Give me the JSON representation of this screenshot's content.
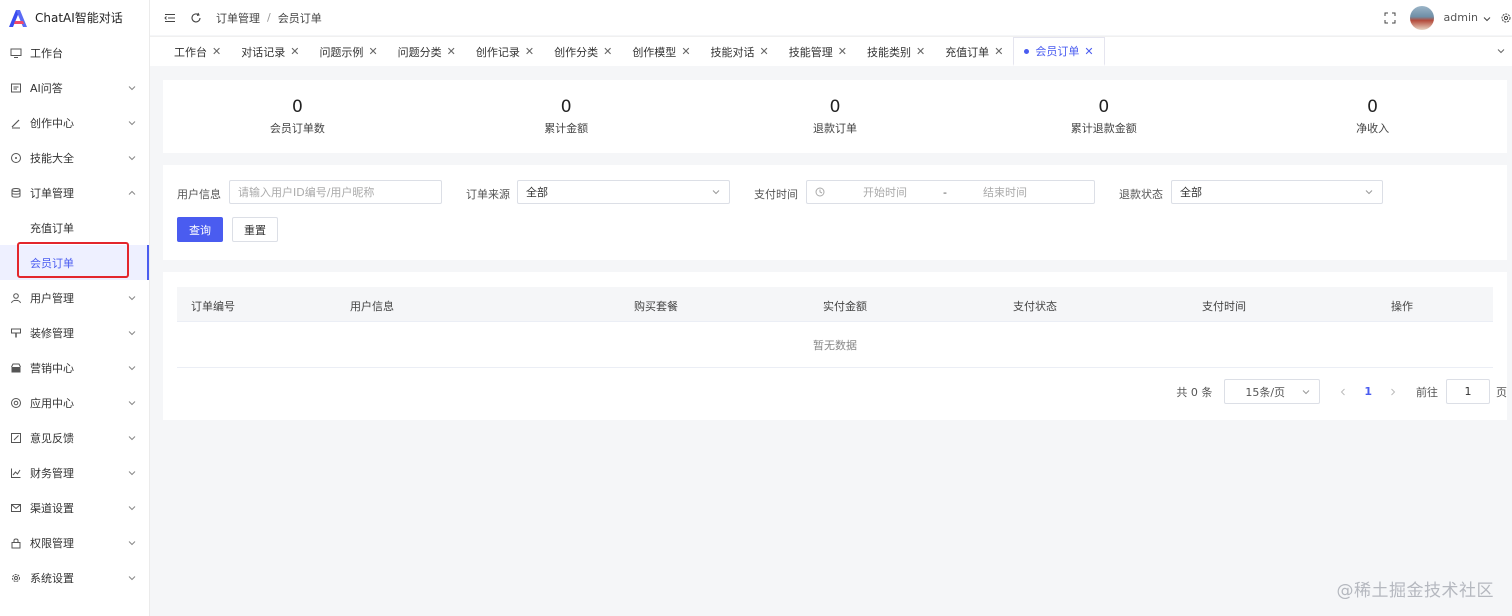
{
  "app": {
    "title": "ChatAI智能对话",
    "accent": "#4a5cf0",
    "highlight_color": "#e3262c"
  },
  "sidebar": {
    "items": [
      {
        "label": "工作台",
        "icon": "monitor-icon",
        "has_arrow": false
      },
      {
        "label": "AI问答",
        "icon": "message-icon",
        "has_arrow": true
      },
      {
        "label": "创作中心",
        "icon": "pen-icon",
        "has_arrow": true
      },
      {
        "label": "技能大全",
        "icon": "circle-icon",
        "has_arrow": true
      },
      {
        "label": "订单管理",
        "icon": "database-icon",
        "has_arrow": true,
        "expanded": true
      },
      {
        "label": "用户管理",
        "icon": "user-icon",
        "has_arrow": true
      },
      {
        "label": "装修管理",
        "icon": "brush-icon",
        "has_arrow": true
      },
      {
        "label": "营销中心",
        "icon": "shop-icon",
        "has_arrow": true
      },
      {
        "label": "应用中心",
        "icon": "app-icon",
        "has_arrow": true
      },
      {
        "label": "意见反馈",
        "icon": "edit-icon",
        "has_arrow": true
      },
      {
        "label": "财务管理",
        "icon": "chart-icon",
        "has_arrow": true
      },
      {
        "label": "渠道设置",
        "icon": "mail-icon",
        "has_arrow": true
      },
      {
        "label": "权限管理",
        "icon": "lock-icon",
        "has_arrow": true
      },
      {
        "label": "系统设置",
        "icon": "gear-icon",
        "has_arrow": true
      }
    ],
    "sub_items": [
      {
        "label": "充值订单",
        "active": false
      },
      {
        "label": "会员订单",
        "active": true
      }
    ]
  },
  "topbar": {
    "breadcrumb": [
      "订单管理",
      "会员订单"
    ],
    "breadcrumb_sep": "/",
    "user": "admin"
  },
  "tabs": [
    {
      "label": "工作台",
      "active": false
    },
    {
      "label": "对话记录",
      "active": false
    },
    {
      "label": "问题示例",
      "active": false
    },
    {
      "label": "问题分类",
      "active": false
    },
    {
      "label": "创作记录",
      "active": false
    },
    {
      "label": "创作分类",
      "active": false
    },
    {
      "label": "创作模型",
      "active": false
    },
    {
      "label": "技能对话",
      "active": false
    },
    {
      "label": "技能管理",
      "active": false
    },
    {
      "label": "技能类别",
      "active": false
    },
    {
      "label": "充值订单",
      "active": false
    },
    {
      "label": "会员订单",
      "active": true
    }
  ],
  "stats": [
    {
      "value": "0",
      "label": "会员订单数"
    },
    {
      "value": "0",
      "label": "累计金额"
    },
    {
      "value": "0",
      "label": "退款订单"
    },
    {
      "value": "0",
      "label": "累计退款金额"
    },
    {
      "value": "0",
      "label": "净收入"
    }
  ],
  "filters": {
    "user_label": "用户信息",
    "user_placeholder": "请输入用户ID编号/用户昵称",
    "source_label": "订单来源",
    "source_value": "全部",
    "pay_time_label": "支付时间",
    "start_placeholder": "开始时间",
    "range_sep": "-",
    "end_placeholder": "结束时间",
    "refund_label": "退款状态",
    "refund_value": "全部",
    "query_button": "查询",
    "reset_button": "重置"
  },
  "table": {
    "columns": [
      "订单编号",
      "用户信息",
      "购买套餐",
      "实付金额",
      "支付状态",
      "支付时间",
      "操作"
    ],
    "empty_text": "暂无数据"
  },
  "pagination": {
    "total": "共 0 条",
    "page_size": "15条/页",
    "current_page": "1",
    "goto_label": "前往",
    "goto_value": "1",
    "page_unit": "页"
  },
  "watermark": "@稀土掘金技术社区"
}
